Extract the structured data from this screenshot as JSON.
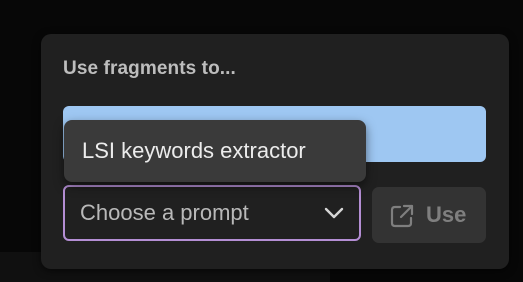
{
  "panel": {
    "title": "Use fragments to..."
  },
  "dropdown": {
    "options": [
      {
        "label": "LSI keywords extractor"
      }
    ]
  },
  "select": {
    "value": "Choose a prompt",
    "chevron_icon": "chevron-down-icon"
  },
  "use_button": {
    "label": "Use",
    "icon": "external-link-icon"
  },
  "colors": {
    "panel_bg": "#202020",
    "accent_blue": "#9ec7f2",
    "focus_border": "#b48ed4",
    "menu_bg": "#3a3a3a",
    "button_bg": "#333333"
  }
}
